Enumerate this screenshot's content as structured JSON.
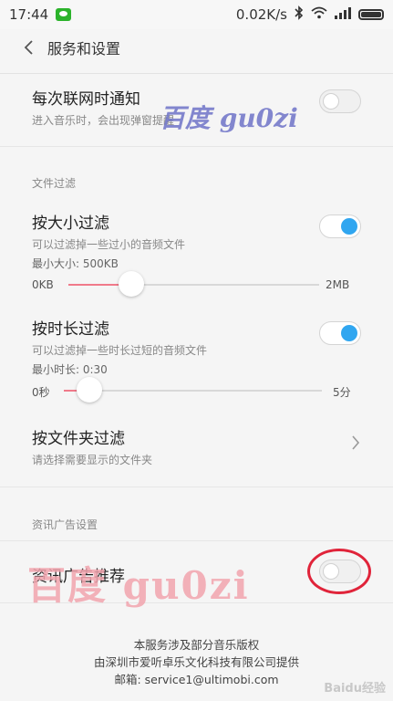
{
  "status_bar": {
    "time": "17:44",
    "speed": "0.02K/s",
    "icons": [
      "wechat-icon",
      "bluetooth-icon",
      "wifi-icon",
      "signal-icon",
      "battery-icon"
    ]
  },
  "header": {
    "title": "服务和设置"
  },
  "settings": {
    "notify": {
      "title": "每次联网时通知",
      "desc": "进入音乐时，会出现弹窗提醒",
      "enabled": false
    },
    "file_filter_header": "文件过滤",
    "size_filter": {
      "title": "按大小过滤",
      "desc": "可以过滤掉一些过小的音频文件",
      "enabled": true,
      "caption": "最小大小: 500KB",
      "min_label": "0KB",
      "max_label": "2MB",
      "value_fraction": 0.25
    },
    "duration_filter": {
      "title": "按时长过滤",
      "desc": "可以过滤掉一些时长过短的音频文件",
      "enabled": true,
      "caption": "最小时长: 0:30",
      "min_label": "0秒",
      "max_label": "5分",
      "value_fraction": 0.1
    },
    "folder_filter": {
      "title": "按文件夹过滤",
      "desc": "请选择需要显示的文件夹"
    },
    "ad_header": "资讯广告设置",
    "ad_recommend": {
      "title": "资讯广告推荐",
      "enabled": false
    }
  },
  "footer": {
    "line1": "本服务涉及部分音乐版权",
    "line2": "由深圳市爱听卓乐文化科技有限公司提供",
    "line3": "邮箱: service1@ultimobi.com"
  },
  "watermarks": {
    "top": "百度 gu0zi",
    "bottom": "百度 gu0zi",
    "corner": "Baidu经验"
  },
  "colors": {
    "accent_blue": "#30a6f0",
    "slider_fill": "#f07a8a",
    "highlight_red": "#e0243a"
  }
}
